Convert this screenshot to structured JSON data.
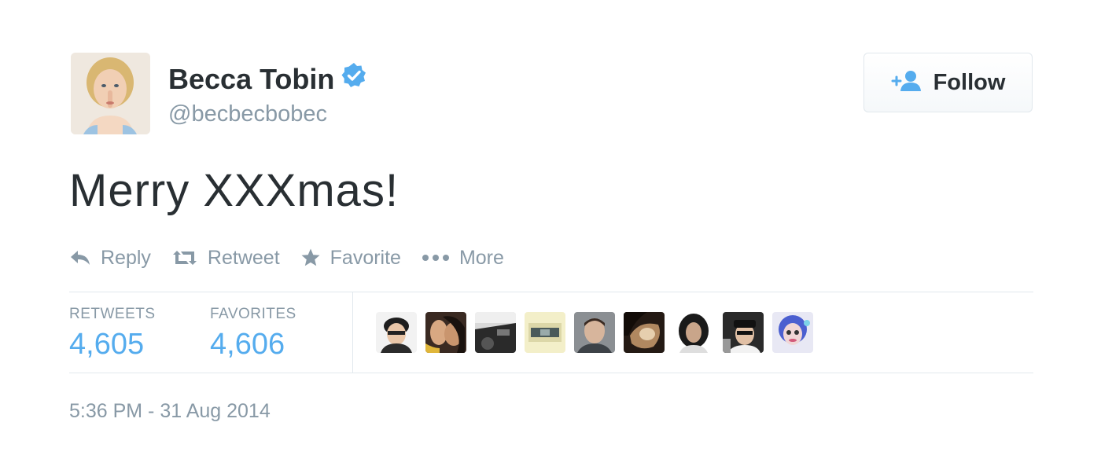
{
  "user": {
    "name": "Becca Tobin",
    "handle": "@becbecbobec",
    "verified": true
  },
  "follow_button": {
    "label": "Follow"
  },
  "tweet": {
    "text": "Merry XXXmas!"
  },
  "actions": {
    "reply": "Reply",
    "retweet": "Retweet",
    "favorite": "Favorite",
    "more": "More"
  },
  "stats": {
    "retweets_label": "RETWEETS",
    "retweets_value": "4,605",
    "favorites_label": "FAVORITES",
    "favorites_value": "4,606"
  },
  "timestamp": "5:36 PM - 31 Aug 2014",
  "colors": {
    "accent": "#55acee",
    "muted": "#8899a6",
    "text": "#292f33",
    "border": "#e1e8ed"
  },
  "icons": {
    "verified": "verified-badge-icon",
    "follow": "add-user-icon",
    "reply": "reply-icon",
    "retweet": "retweet-icon",
    "favorite": "star-icon",
    "more": "more-dots-icon"
  }
}
